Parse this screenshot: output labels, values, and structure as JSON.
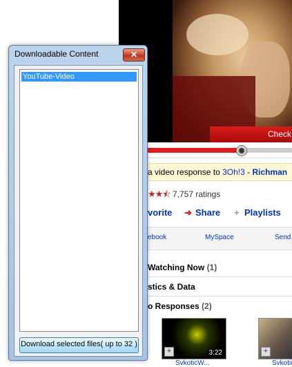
{
  "dialog": {
    "title": "Downloadable Content",
    "close_label": "✕",
    "items": [
      {
        "label": "YouTube-Video",
        "selected": true
      }
    ],
    "download_button": "Download selected files( up to 32 )"
  },
  "background": {
    "banner": "Check",
    "response": {
      "prefix": "a video response to ",
      "channel": "3Oh!3",
      "separator": " - ",
      "title": "Richman"
    },
    "ratings": {
      "stars": "★★⯪",
      "count_text": "7,757 ratings"
    },
    "actions": {
      "favorite": "vorite",
      "share_icon": "➜",
      "share": "Share",
      "playlists_icon": "+",
      "playlists": "Playlists"
    },
    "share_links": [
      "ebook",
      "MySpace",
      "Send"
    ],
    "sections": [
      {
        "label": "Watching Now",
        "count": "(1)"
      },
      {
        "label": "stics & Data",
        "count": ""
      },
      {
        "label": "o Responses",
        "count": "(2)"
      }
    ],
    "thumbs": [
      {
        "duration": "3:22",
        "caption": "SvkoticW..."
      },
      {
        "duration": "",
        "caption": "Svkotic"
      }
    ],
    "colors": {
      "accent": "#e51b1b",
      "link": "#0033cc",
      "selection": "#3399ff"
    }
  }
}
